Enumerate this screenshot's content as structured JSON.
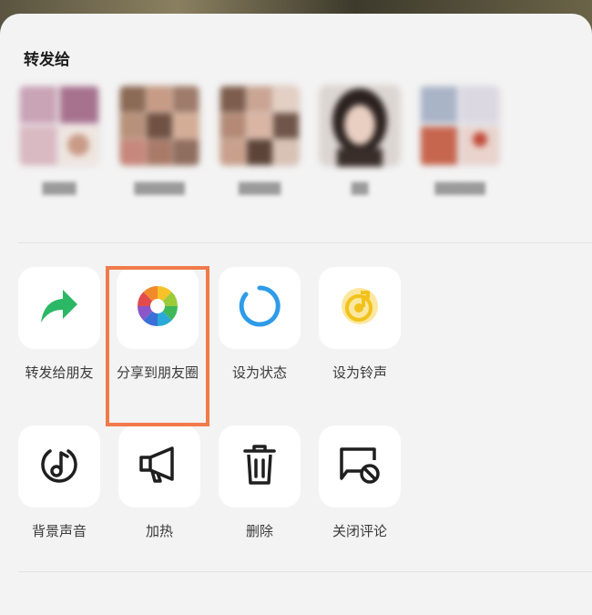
{
  "share_sheet": {
    "title": "转发给",
    "contacts": [
      {
        "name": "████"
      },
      {
        "name": "██████"
      },
      {
        "name": "█████"
      },
      {
        "name": "██"
      },
      {
        "name": "██████"
      }
    ],
    "actions_row1": [
      {
        "label": "转发给朋友",
        "icon": "share-arrow-icon"
      },
      {
        "label": "分享到朋友圈",
        "icon": "moments-aperture-icon"
      },
      {
        "label": "设为状态",
        "icon": "status-ring-icon"
      },
      {
        "label": "设为铃声",
        "icon": "ringtone-icon"
      }
    ],
    "actions_row2": [
      {
        "label": "背景声音",
        "icon": "music-note-icon"
      },
      {
        "label": "加热",
        "icon": "megaphone-icon"
      },
      {
        "label": "删除",
        "icon": "trash-icon"
      },
      {
        "label": "关闭评论",
        "icon": "comment-off-icon"
      }
    ],
    "highlight_color": "#f07a4a",
    "colors": {
      "share_green": "#2bb865",
      "status_blue": "#2e9be8",
      "ringtone_yellow": "#f2c21b"
    }
  }
}
